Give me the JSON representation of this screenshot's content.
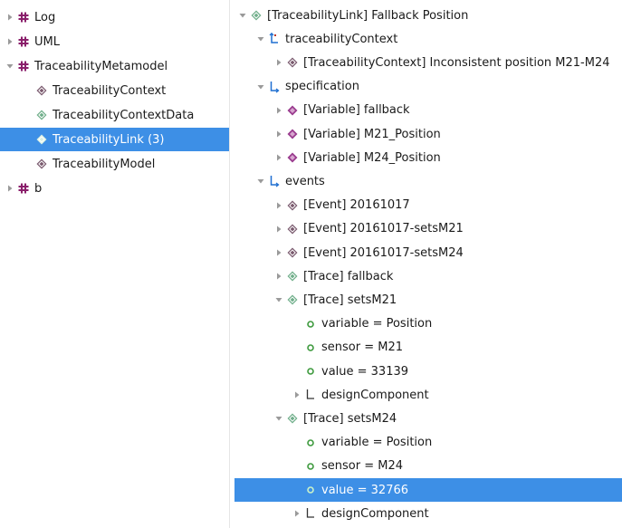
{
  "colors": {
    "selection": "#3d8fe6",
    "package_icon": "#8a1f6b",
    "class_icon": "#7a5a6e",
    "trace_icon": "#6fae8a",
    "reference_icon": "#1f6fd1",
    "attribute_dot": "#3e9a3e"
  },
  "left_tree": [
    {
      "label": "Log",
      "icon": "package-icon",
      "twisty": "collapsed",
      "level": 0
    },
    {
      "label": "UML",
      "icon": "package-icon",
      "twisty": "collapsed",
      "level": 0
    },
    {
      "label": "TraceabilityMetamodel",
      "icon": "package-icon",
      "twisty": "expanded",
      "level": 0
    },
    {
      "label": "TraceabilityContext",
      "icon": "class-icon",
      "twisty": "none",
      "level": 1
    },
    {
      "label": "TraceabilityContextData",
      "icon": "trace-icon",
      "twisty": "none",
      "level": 1
    },
    {
      "label": "TraceabilityLink (3)",
      "icon": "trace-icon",
      "twisty": "none",
      "level": 1,
      "selected": true
    },
    {
      "label": "TraceabilityModel",
      "icon": "class-icon",
      "twisty": "none",
      "level": 1
    },
    {
      "label": "b",
      "icon": "package-icon",
      "twisty": "collapsed",
      "level": 0
    }
  ],
  "right_tree": [
    {
      "label": "[TraceabilityLink] Fallback Position",
      "icon": "trace-icon",
      "twisty": "expanded",
      "level": 0
    },
    {
      "label": "traceabilityContext",
      "icon": "reference-single-icon",
      "twisty": "expanded",
      "level": 1
    },
    {
      "label": "[TraceabilityContext] Inconsistent position M21-M24",
      "icon": "class-icon",
      "twisty": "collapsed",
      "level": 2
    },
    {
      "label": "specification",
      "icon": "reference-many-icon",
      "twisty": "expanded",
      "level": 1
    },
    {
      "label": "[Variable] fallback",
      "icon": "variable-icon",
      "twisty": "collapsed",
      "level": 2
    },
    {
      "label": "[Variable] M21_Position",
      "icon": "variable-icon",
      "twisty": "collapsed",
      "level": 2
    },
    {
      "label": "[Variable] M24_Position",
      "icon": "variable-icon",
      "twisty": "collapsed",
      "level": 2
    },
    {
      "label": "events",
      "icon": "reference-many-icon",
      "twisty": "expanded",
      "level": 1
    },
    {
      "label": "[Event] 20161017",
      "icon": "class-icon",
      "twisty": "collapsed",
      "level": 2
    },
    {
      "label": "[Event] 20161017-setsM21",
      "icon": "class-icon",
      "twisty": "collapsed",
      "level": 2
    },
    {
      "label": "[Event] 20161017-setsM24",
      "icon": "class-icon",
      "twisty": "collapsed",
      "level": 2
    },
    {
      "label": "[Trace] fallback",
      "icon": "trace-icon",
      "twisty": "collapsed",
      "level": 2
    },
    {
      "label": "[Trace] setsM21",
      "icon": "trace-icon",
      "twisty": "expanded",
      "level": 2
    },
    {
      "label": "variable = Position",
      "icon": "attribute-icon",
      "twisty": "none",
      "level": 3
    },
    {
      "label": "sensor = M21",
      "icon": "attribute-icon",
      "twisty": "none",
      "level": 3
    },
    {
      "label": "value = 33139",
      "icon": "attribute-icon",
      "twisty": "none",
      "level": 3
    },
    {
      "label": "designComponent",
      "icon": "reference-plain-icon",
      "twisty": "collapsed",
      "level": 3
    },
    {
      "label": "[Trace] setsM24",
      "icon": "trace-icon",
      "twisty": "expanded",
      "level": 2
    },
    {
      "label": "variable = Position",
      "icon": "attribute-icon",
      "twisty": "none",
      "level": 3
    },
    {
      "label": "sensor = M24",
      "icon": "attribute-icon",
      "twisty": "none",
      "level": 3
    },
    {
      "label": "value = 32766",
      "icon": "attribute-icon",
      "twisty": "none",
      "level": 3,
      "selected": true
    },
    {
      "label": "designComponent",
      "icon": "reference-plain-icon",
      "twisty": "collapsed",
      "level": 3
    }
  ]
}
